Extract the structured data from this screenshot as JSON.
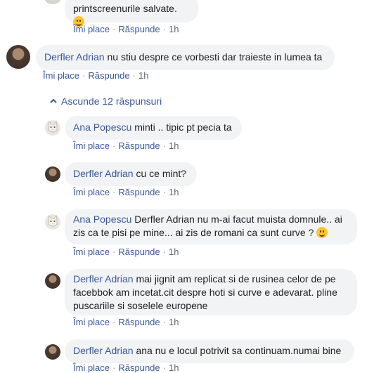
{
  "labels": {
    "like": "Îmi place",
    "reply": "Răspunde",
    "sep": "·"
  },
  "toggle": {
    "label": "Ascunde 12 răspunsuri"
  },
  "comments": [
    {
      "author": "",
      "text": "printscreenurile salvate.",
      "time": "1h"
    },
    {
      "author": "Derfler Adrian",
      "text": "nu stiu despre ce vorbesti dar traieste in lumea ta",
      "time": "1h"
    },
    {
      "author": "Ana Popescu",
      "text": "minti .. tipic pt pecia ta",
      "time": "1h"
    },
    {
      "author": "Derfler Adrian",
      "text": "cu ce mint?",
      "time": "1h"
    },
    {
      "author": "Ana Popescu",
      "text": "Derfler Adrian nu m-ai facut muista domnule.. ai zis ca te pisi pe mine... ai zis de romani ca sunt curve ?",
      "time": "1h"
    },
    {
      "author": "Derfler Adrian",
      "text": "mai jignit am replicat si de rusinea celor de pe facebbok am incetat.cit despre hoti si curve e adevarat. pline puscariile si soselele europene",
      "time": "1h"
    },
    {
      "author": "Derfler Adrian",
      "text": "ana nu e locul potrivit sa continuam.numai bine",
      "time": "1h"
    }
  ]
}
